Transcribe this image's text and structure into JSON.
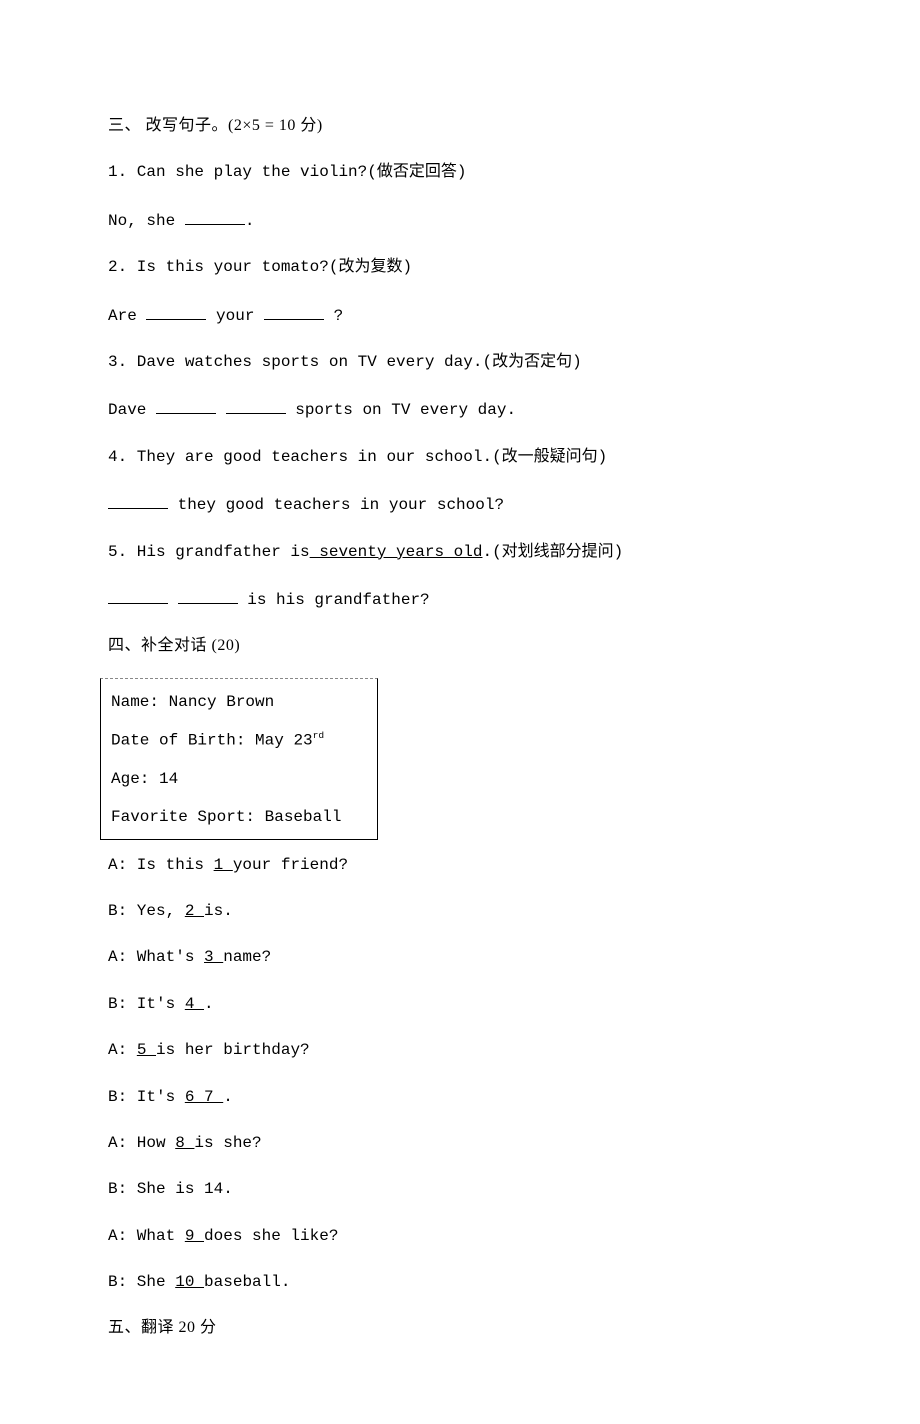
{
  "section3": {
    "heading": "三、 改写句子。(2×5 = 10 分)",
    "q1": {
      "prompt": "1. Can she play the violin?(做否定回答)",
      "answer_prefix": "No, she ",
      "answer_suffix": "."
    },
    "q2": {
      "prompt": "2. Is this your tomato?(改为复数)",
      "ans_a": "Are ",
      "ans_b": " your ",
      "ans_c": " ?"
    },
    "q3": {
      "prompt": "3. Dave watches sports on TV every day.(改为否定句)",
      "ans_a": "Dave ",
      "ans_b": " ",
      "ans_c": " sports on TV every day."
    },
    "q4": {
      "prompt": "4. They are good teachers in our school.(改一般疑问句)",
      "ans_a": "",
      "ans_b": " they good teachers in your school?"
    },
    "q5": {
      "prompt_a": "5. His grandfather is",
      "prompt_u": " seventy years old",
      "prompt_b": ".(对划线部分提问)",
      "ans_a": "",
      "ans_b": " ",
      "ans_c": " is his grandfather?"
    }
  },
  "section4": {
    "heading": "四、补全对话 (20)",
    "card": {
      "name_label": "Name: ",
      "name_value": "Nancy Brown",
      "dob_label": "Date of Birth: ",
      "dob_value_a": "May 23",
      "dob_value_sup": "rd",
      "age_label": "Age: ",
      "age_value": "14",
      "fav_label": "Favorite Sport: ",
      "fav_value": "Baseball"
    },
    "dlg": {
      "a1_a": "A: Is this ",
      "a1_n": " 1 ",
      "a1_b": " your friend?",
      "b1_a": "B: Yes, ",
      "b1_n": " 2 ",
      "b1_b": " is.",
      "a2_a": "A: What's ",
      "a2_n": " 3  ",
      "a2_b": "name?",
      "b2_a": "B: It's ",
      "b2_n": " 4 ",
      "b2_b": " .",
      "a3_a": "A: ",
      "a3_n": " 5 ",
      "a3_b": " is her birthday?",
      "b3_a": "B: It's ",
      "b3_n1": " 6  ",
      "b3_mid": "  ",
      "b3_n2": " 7 ",
      "b3_b": ".",
      "a4_a": "A: How ",
      "a4_n": " 8 ",
      "a4_b": " is she?",
      "b4": "B: She is 14.",
      "a5_a": "A: What ",
      "a5_n": " 9 ",
      "a5_b": " does she like?",
      "b5_a": "B: She ",
      "b5_n": " 10 ",
      "b5_b": " baseball."
    }
  },
  "section5": {
    "heading": "五、翻译 20 分"
  }
}
